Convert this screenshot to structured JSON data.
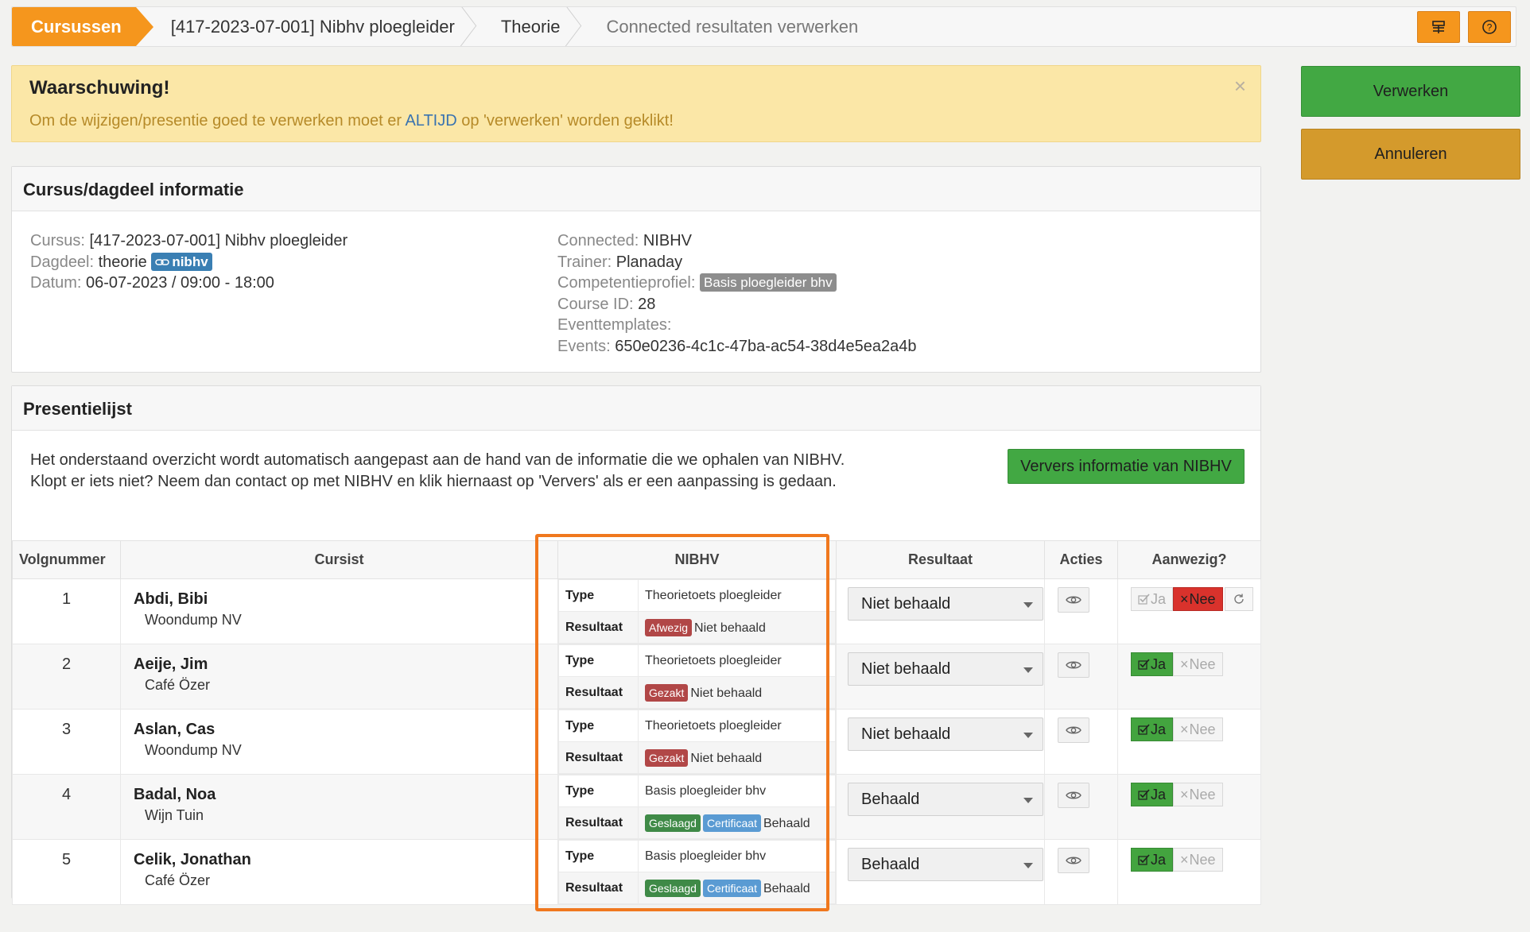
{
  "breadcrumb": {
    "items": [
      "Cursussen",
      "[417-2023-07-001] Nibhv ploegleider",
      "Theorie",
      "Connected resultaten verwerken"
    ]
  },
  "alert": {
    "title": "Waarschuwing!",
    "text_before": "Om de wijzigen/presentie goed te verwerken moet er ",
    "text_highlight": "ALTIJD",
    "text_after": " op 'verwerken' worden geklikt!",
    "close": "×"
  },
  "actions": {
    "process": "Verwerken",
    "cancel": "Annuleren"
  },
  "info": {
    "title": "Cursus/dagdeel informatie",
    "cursus_label": "Cursus:",
    "cursus_value": " [417-2023-07-001] Nibhv ploegleider",
    "dagdeel_label": "Dagdeel:",
    "dagdeel_value": " theorie ",
    "dagdeel_badge": "nibhv",
    "datum_label": "Datum:",
    "datum_value": " 06-07-2023 / 09:00 - 18:00",
    "connected_label": "Connected:",
    "connected_value": " NIBHV",
    "trainer_label": "Trainer:",
    "trainer_value": " Planaday",
    "profiel_label": "Competentieprofiel:",
    "profiel_badge": "Basis ploegleider bhv",
    "courseid_label": "Course ID:",
    "courseid_value": " 28",
    "eventtemplates_label": "Eventtemplates:",
    "events_label": "Events:",
    "events_value": " 650e0236-4c1c-47ba-ac54-38d4e5ea2a4b"
  },
  "presence": {
    "title": "Presentielijst",
    "text": "Het onderstaand overzicht wordt automatisch aangepast aan de hand van de informatie die we ophalen van NIBHV. Klopt er iets niet? Neem dan contact op met NIBHV en klik hiernaast op 'Ververs' als er een aanpassing is gedaan.",
    "refresh": "Ververs informatie van NIBHV"
  },
  "table": {
    "headers": [
      "Volgnummer",
      "Cursist",
      "NIBHV",
      "Resultaat",
      "Acties",
      "Aanwezig?"
    ],
    "type_label": "Type",
    "result_label": "Resultaat",
    "ja": "Ja",
    "nee": "Nee",
    "rows": [
      {
        "num": "1",
        "name": "Abdi, Bibi",
        "company": "Woondump NV",
        "type": "Theorietoets ploegleider",
        "tags": [
          {
            "text": "Afwezig",
            "color": "#b14747"
          }
        ],
        "nibhv_result": "Niet behaald",
        "resultaat": "Niet behaald",
        "present": "nee"
      },
      {
        "num": "2",
        "name": "Aeije, Jim",
        "company": "Café Özer",
        "type": "Theorietoets ploegleider",
        "tags": [
          {
            "text": "Gezakt",
            "color": "#b14747"
          }
        ],
        "nibhv_result": "Niet behaald",
        "resultaat": "Niet behaald",
        "present": "ja"
      },
      {
        "num": "3",
        "name": "Aslan, Cas",
        "company": "Woondump NV",
        "type": "Theorietoets ploegleider",
        "tags": [
          {
            "text": "Gezakt",
            "color": "#b14747"
          }
        ],
        "nibhv_result": "Niet behaald",
        "resultaat": "Niet behaald",
        "present": "ja"
      },
      {
        "num": "4",
        "name": "Badal, Noa",
        "company": "Wijn Tuin",
        "type": "Basis ploegleider bhv",
        "tags": [
          {
            "text": "Geslaagd",
            "color": "#3f8a47"
          },
          {
            "text": "Certificaat",
            "color": "#5a9bd3"
          }
        ],
        "nibhv_result": "Behaald",
        "resultaat": "Behaald",
        "present": "ja"
      },
      {
        "num": "5",
        "name": "Celik, Jonathan",
        "company": "Café Özer",
        "type": "Basis ploegleider bhv",
        "tags": [
          {
            "text": "Geslaagd",
            "color": "#3f8a47"
          },
          {
            "text": "Certificaat",
            "color": "#5a9bd3"
          }
        ],
        "nibhv_result": "Behaald",
        "resultaat": "Behaald",
        "present": "ja"
      }
    ]
  },
  "colors": {
    "accent": "#f5961d",
    "success": "#42a843",
    "warning_bg": "#fbe7a7",
    "highlight_border": "#f0781e"
  },
  "icons": {
    "topbar_1": "list-icon",
    "topbar_2": "help-circle-icon",
    "badge": "link-icon",
    "view": "eye-icon",
    "reset": "refresh-icon"
  }
}
